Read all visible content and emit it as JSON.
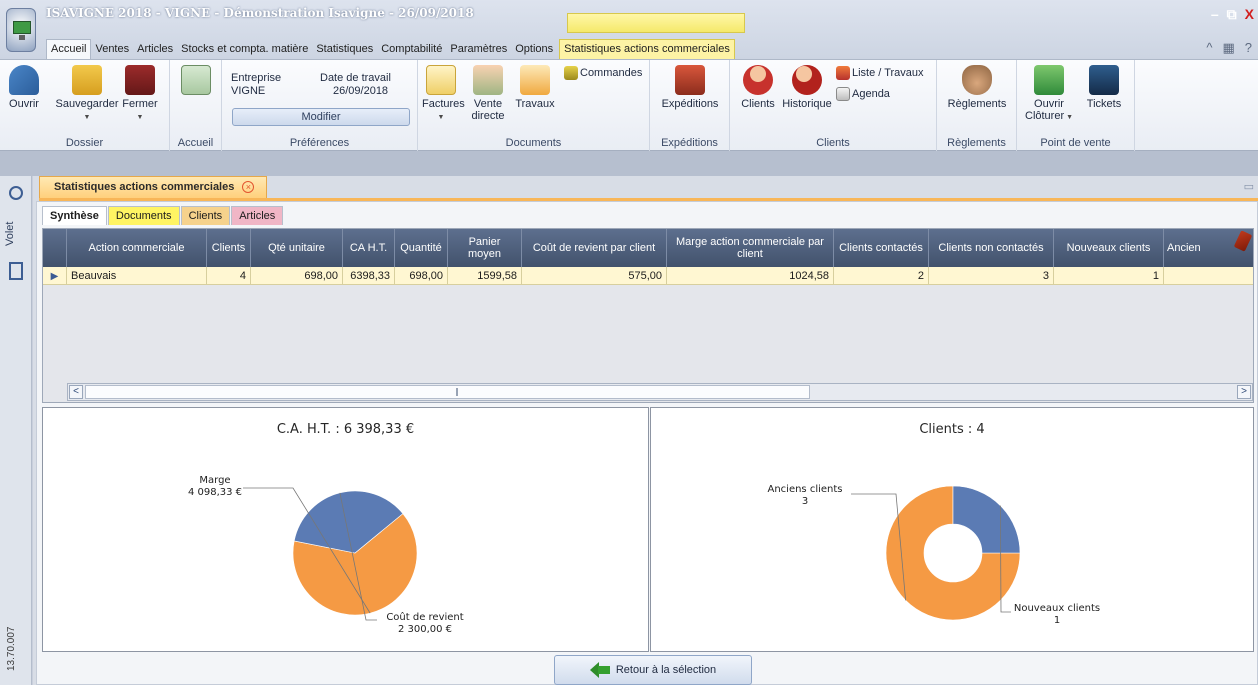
{
  "window": {
    "title": "ISAVIGNE 2018 - VIGNE - Démonstration Isavigne - 26/09/2018",
    "controls": {
      "minimize": "–",
      "restore": "⧉",
      "close": "X"
    }
  },
  "menu": {
    "tabs": [
      "Accueil",
      "Ventes",
      "Articles",
      "Stocks et compta. matière",
      "Statistiques",
      "Comptabilité",
      "Paramètres",
      "Options"
    ],
    "context_tab": "Statistiques actions commerciales",
    "right_icons": {
      "collapse": "^",
      "calc": "▦",
      "help": "?"
    }
  },
  "ribbon": {
    "dossier": {
      "label": "Dossier",
      "open": "Ouvrir",
      "save": "Sauvegarder",
      "close": "Fermer"
    },
    "accueil": {
      "label": "Accueil"
    },
    "preferences": {
      "label": "Préférences",
      "company_label": "Entreprise",
      "company_value": "VIGNE",
      "date_label": "Date de travail",
      "date_value": "26/09/2018",
      "modify": "Modifier"
    },
    "documents": {
      "label": "Documents",
      "invoices": "Factures",
      "direct_sale_1": "Vente",
      "direct_sale_2": "directe",
      "works": "Travaux",
      "orders": "Commandes"
    },
    "expeditions": {
      "label": "Expéditions",
      "button": "Expéditions"
    },
    "clients": {
      "label": "Clients",
      "clients": "Clients",
      "history": "Historique",
      "list_work": "Liste / Travaux",
      "agenda": "Agenda"
    },
    "reglements": {
      "label": "Règlements",
      "button": "Règlements"
    },
    "pos": {
      "label": "Point de vente",
      "open_close_1": "Ouvrir",
      "open_close_2": "Clôturer",
      "tickets": "Tickets"
    }
  },
  "left_strip": {
    "volet": "Volet",
    "version": "13.70.007"
  },
  "document": {
    "tab_label": "Statistiques actions commerciales",
    "close_glyph": "×",
    "sub_tabs": [
      "Synthèse",
      "Documents",
      "Clients",
      "Articles"
    ]
  },
  "grid": {
    "columns": [
      "Action commerciale",
      "Clients",
      "Qté unitaire",
      "CA H.T.",
      "Quantité",
      "Panier moyen",
      "Coût de revient par client",
      "Marge action commerciale par client",
      "Clients contactés",
      "Clients non contactés",
      "Nouveaux clients",
      "Ancien"
    ],
    "rows": [
      [
        "Beauvais",
        "4",
        "698,00",
        "6398,33",
        "698,00",
        "1599,58",
        "575,00",
        "1024,58",
        "2",
        "3",
        "1",
        ""
      ]
    ],
    "scroll_left": "<",
    "scroll_right": ">"
  },
  "chart_data": [
    {
      "type": "pie",
      "title": "C.A. H.T. : 6 398,33 €",
      "slices": [
        {
          "label": "Marge",
          "value": 4098.33,
          "value_text": "4 098,33 €",
          "color": "#f59a44"
        },
        {
          "label": "Coût de revient",
          "value": 2300.0,
          "value_text": "2 300,00 €",
          "color": "#5b7bb4"
        }
      ]
    },
    {
      "type": "pie",
      "donut": true,
      "title": "Clients : 4",
      "slices": [
        {
          "label": "Anciens clients",
          "value": 3,
          "value_text": "3",
          "color": "#f59a44"
        },
        {
          "label": "Nouveaux clients",
          "value": 1,
          "value_text": "1",
          "color": "#5b7bb4"
        }
      ]
    }
  ],
  "footer": {
    "back_button": "Retour à la sélection"
  }
}
